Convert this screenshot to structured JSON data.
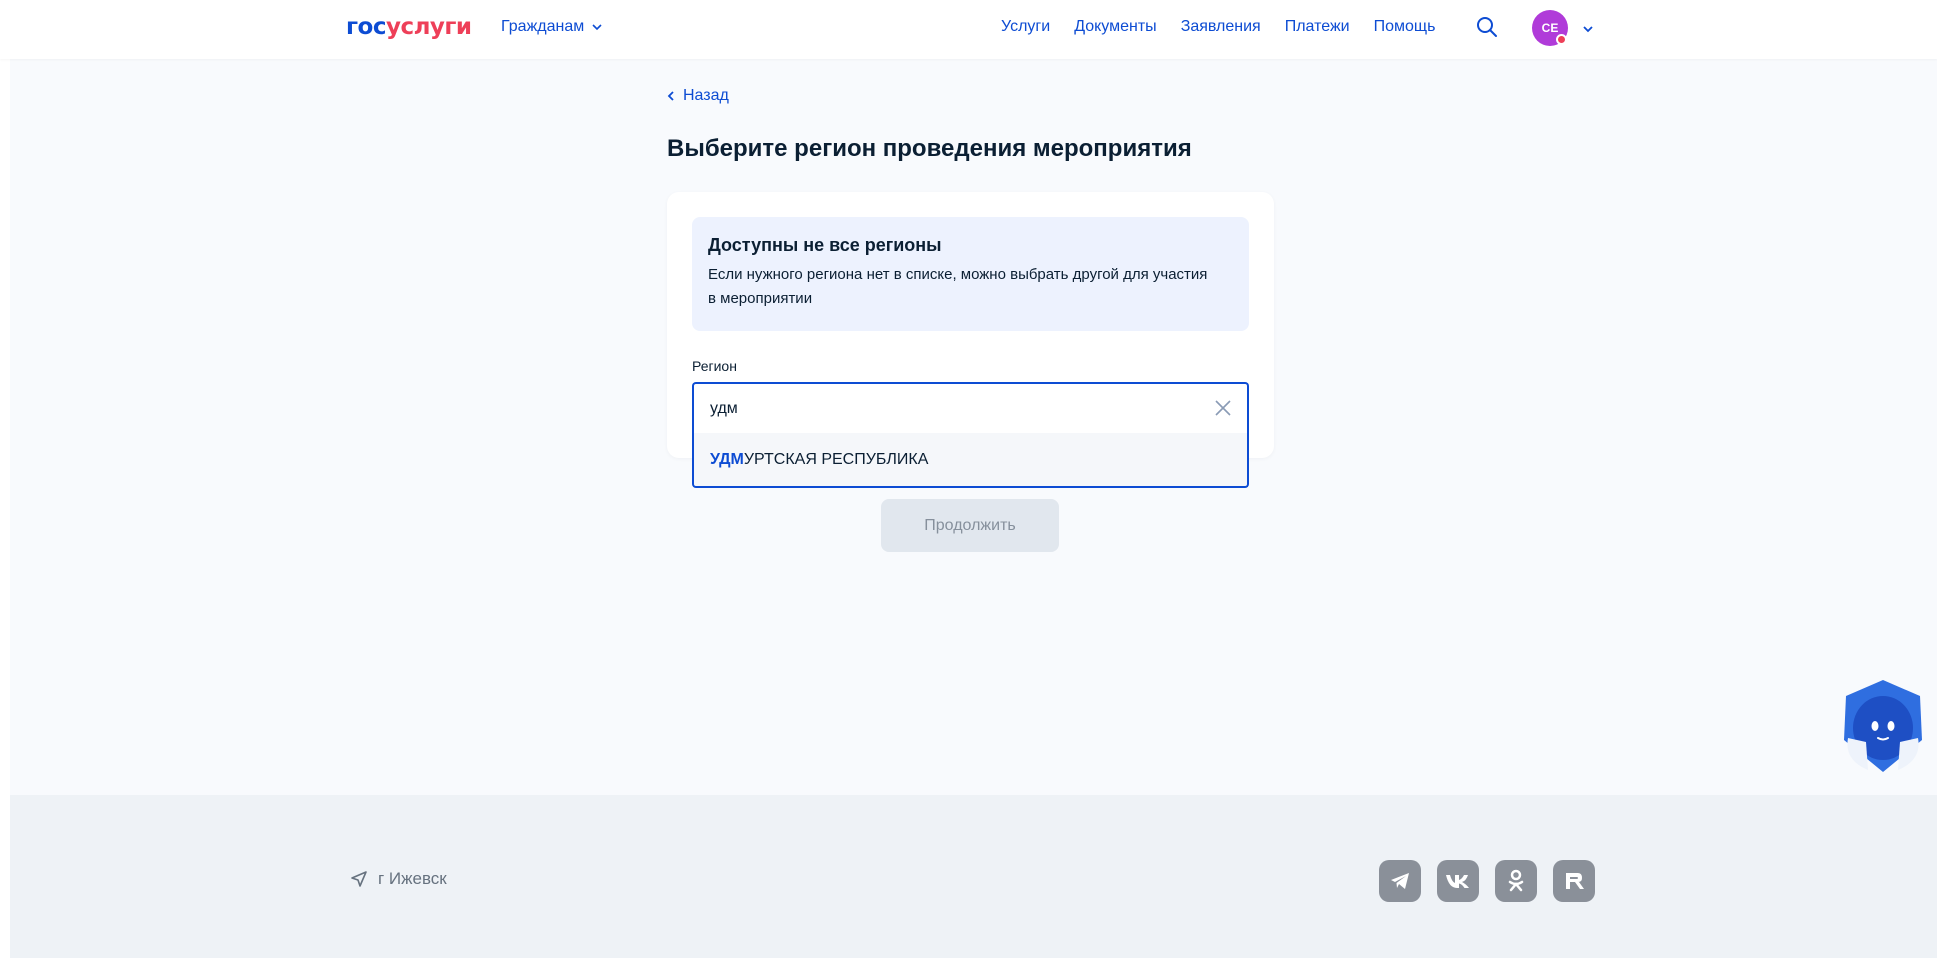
{
  "header": {
    "logo": {
      "part1": "гос",
      "part2": "услуги"
    },
    "audience_label": "Гражданам",
    "nav": [
      "Услуги",
      "Документы",
      "Заявления",
      "Платежи",
      "Помощь"
    ],
    "avatar_initials": "CE"
  },
  "main": {
    "back_label": "Назад",
    "title": "Выберите регион проведения мероприятия",
    "info": {
      "title": "Доступны не все регионы",
      "text": "Если нужного региона нет в списке, можно выбрать другой для участия в мероприятии"
    },
    "region_field": {
      "label": "Регион",
      "value": "удм"
    },
    "suggestion": {
      "match": "УДМ",
      "rest": "УРТСКАЯ РЕСПУБЛИКА"
    },
    "continue_label": "Продолжить"
  },
  "footer": {
    "city": "г Ижевск",
    "socials": [
      "telegram-icon",
      "vk-icon",
      "odnoklassniki-icon",
      "rutube-icon"
    ]
  },
  "colors": {
    "brand_blue": "#0d4cd3",
    "brand_red": "#ee3f58",
    "avatar_purple": "#b03bd9",
    "page_bg": "#f8fafd",
    "footer_bg": "#eef2f6"
  }
}
